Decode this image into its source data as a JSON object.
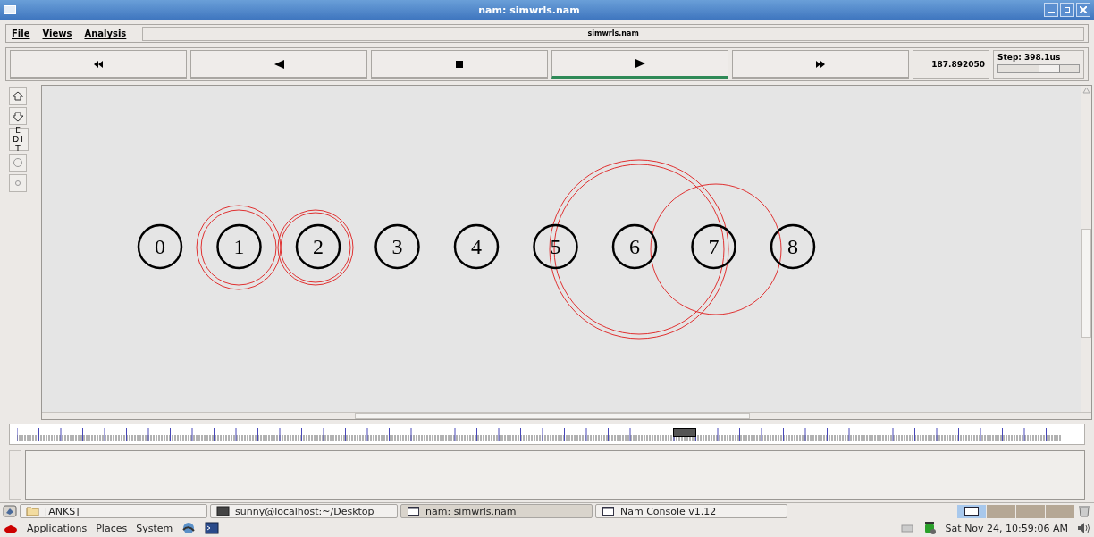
{
  "window": {
    "title": "nam: simwrls.nam"
  },
  "menu": [
    {
      "label": "File"
    },
    {
      "label": "Views"
    },
    {
      "label": "Analysis"
    }
  ],
  "menu_status": "simwrls.nam",
  "playback": [
    {
      "kind": "rewind",
      "selected": false
    },
    {
      "kind": "back",
      "selected": false
    },
    {
      "kind": "stop",
      "selected": false
    },
    {
      "kind": "play",
      "selected": true
    },
    {
      "kind": "forward",
      "selected": false
    }
  ],
  "time": "187.892050",
  "step": {
    "label": "Step: 398.1us",
    "level": 0.62
  },
  "edit_button": "EDIT",
  "nodes": [
    "0",
    "1",
    "2",
    "3",
    "4",
    "5",
    "6",
    "7",
    "8"
  ],
  "timeline": {
    "level": 0.63
  },
  "taskbar": [
    {
      "label": "[ANKS]",
      "kind": "folder",
      "selected": false
    },
    {
      "label": "sunny@localhost:~/Desktop",
      "kind": "terminal",
      "selected": false
    },
    {
      "label": "nam: simwrls.nam",
      "kind": "window",
      "selected": true
    },
    {
      "label": "Nam Console v1.12",
      "kind": "window",
      "selected": false
    }
  ],
  "workspaces": [
    {
      "selected": true
    },
    {
      "selected": false
    },
    {
      "selected": false
    },
    {
      "selected": false
    }
  ],
  "panel_menu": [
    "Applications",
    "Places",
    "System"
  ],
  "clock": "Sat Nov 24, 10:59:06 AM"
}
